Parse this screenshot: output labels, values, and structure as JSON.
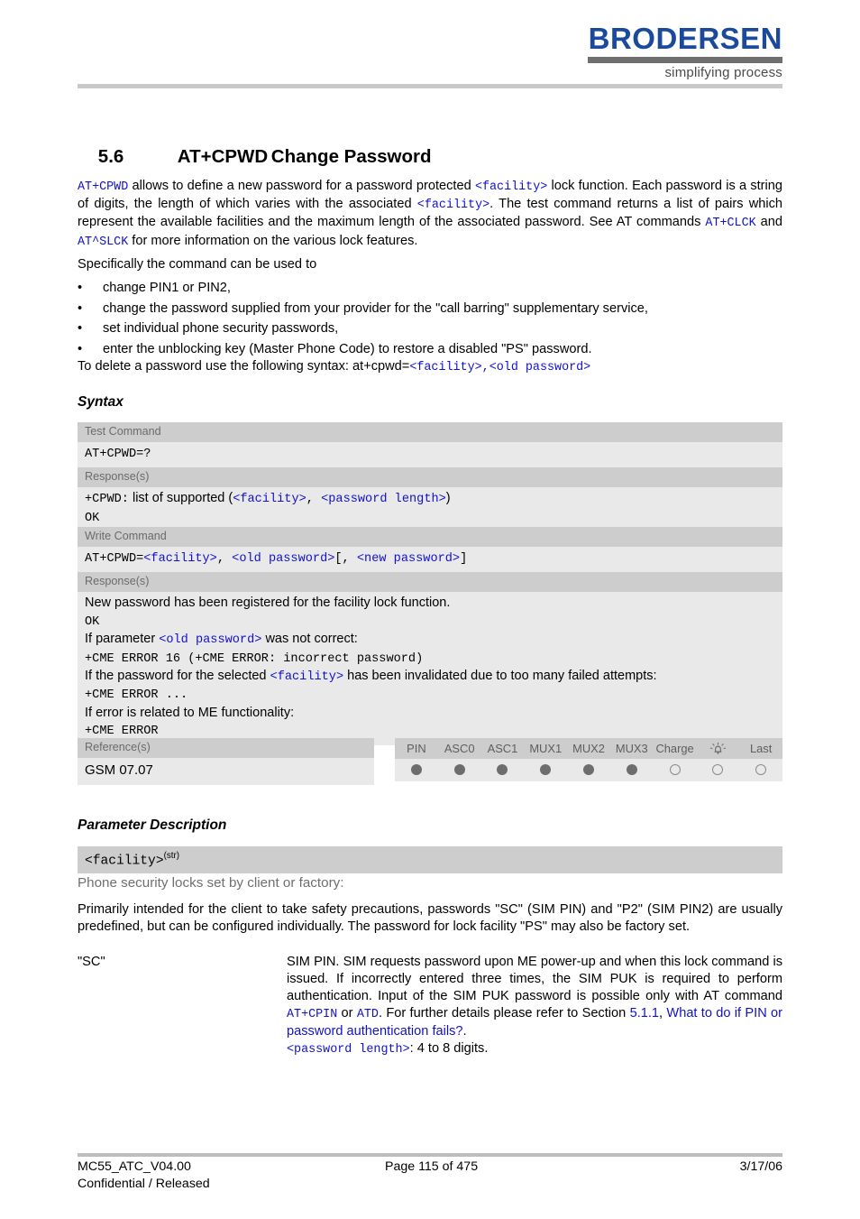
{
  "header": {
    "logo_word": "BRODERSEN",
    "logo_tagline": "simplifying process",
    "logo_color": "#1b4a9c"
  },
  "title": {
    "number": "5.6",
    "command": "AT+CPWD",
    "name": "Change Password"
  },
  "intro": {
    "p1_a": "AT+CPWD",
    "p1_b": " allows to define a new password for a password protected ",
    "p1_c": "<facility>",
    "p1_d": " lock function. Each password is a string of digits, the length of which varies with the associated ",
    "p1_e": "<facility>",
    "p1_f": ". The test command returns a list of pairs which represent the available facilities and the maximum length of the associated password. See AT commands ",
    "p1_g": "AT+CLCK",
    "p1_h": " and ",
    "p1_i": "AT^SLCK",
    "p1_j": " for more information on the various lock features.",
    "lead_in": "Specifically the command can be used to",
    "bullets": [
      "change PIN1 or PIN2,",
      "change the password supplied from your provider for the \"call barring\" supplementary service,",
      "set individual phone security passwords,",
      "enter the unblocking key (Master Phone Code) to restore a disabled \"PS\" password."
    ],
    "bullet_marker": "•",
    "delete_a": "To delete a password use the following syntax: at+cpwd=",
    "delete_b": "<facility>",
    "delete_c": ",",
    "delete_d": "<old password>"
  },
  "syntax": {
    "heading": "Syntax",
    "test": {
      "label": "Test Command",
      "command": "AT+CPWD=?",
      "response_label": "Response(s)",
      "resp_a": "+CPWD:",
      "resp_b": " list of supported (",
      "resp_c": "<facility>",
      "resp_d": ", ",
      "resp_e": "<password length>",
      "resp_f": ")",
      "ok": "OK"
    },
    "write": {
      "label": "Write Command",
      "cmd_a": "AT+CPWD=",
      "cmd_b": "<facility>",
      "cmd_c": ", ",
      "cmd_d": "<old password>",
      "cmd_e": "[, ",
      "cmd_f": "<new password>",
      "cmd_g": "]",
      "response_label": "Response(s)",
      "r1": "New password has been registered for the facility lock function.",
      "r2": "OK",
      "r3_a": "If parameter ",
      "r3_b": "<old password>",
      "r3_c": " was not correct:",
      "r4": "+CME ERROR 16 (+CME ERROR: incorrect password)",
      "r5_a": "If the password for the selected ",
      "r5_b": "<facility>",
      "r5_c": " has been invalidated due to too many failed attempts:",
      "r6": "+CME ERROR ...",
      "r7": "If error is related to ME functionality:",
      "r8": "+CME ERROR"
    }
  },
  "reference": {
    "label": "Reference(s)",
    "value": "GSM 07.07"
  },
  "ports": {
    "columns": [
      "PIN",
      "ASC0",
      "ASC1",
      "MUX1",
      "MUX2",
      "MUX3",
      "Charge",
      "alarm-icon",
      "Last"
    ],
    "alarm_column_index": 7,
    "states": [
      "on",
      "on",
      "on",
      "on",
      "on",
      "on",
      "off",
      "off",
      "off"
    ],
    "on_color": "#6d6d6d",
    "off_color": "#8a8a8a"
  },
  "parameters": {
    "heading": "Parameter Description",
    "facility": {
      "name": "<facility>",
      "type_sup": "(str)",
      "subtitle": "Phone security locks set by client or factory:",
      "description": "Primarily intended for the client to take safety precautions, passwords \"SC\" (SIM PIN) and \"P2\" (SIM PIN2) are usually predefined, but can be configured individually. The password for lock facility \"PS\" may also be factory set."
    },
    "entries": [
      {
        "term": "\"SC\"",
        "d1": "SIM PIN. SIM requests password upon ME power-up and when this lock command is issued.",
        "d2_a": "If incorrectly entered three times, the SIM PUK is required to perform authentication. Input of the SIM PUK password is possible only with AT command ",
        "d2_b": "AT+CPIN",
        "d2_c": " or ",
        "d2_d": "ATD",
        "d2_e": ". For further details please refer to Section ",
        "d2_f": "5.1.1",
        "d2_g": ", ",
        "d2_h": "What to do if PIN or password authentication fails?",
        "d2_i": ".",
        "d3_a": "<password length>",
        "d3_b": ": 4 to 8 digits."
      }
    ]
  },
  "footer": {
    "doc_id": "MC55_ATC_V04.00",
    "classification": "Confidential / Released",
    "page": "Page 115 of 475",
    "date": "3/17/06"
  }
}
